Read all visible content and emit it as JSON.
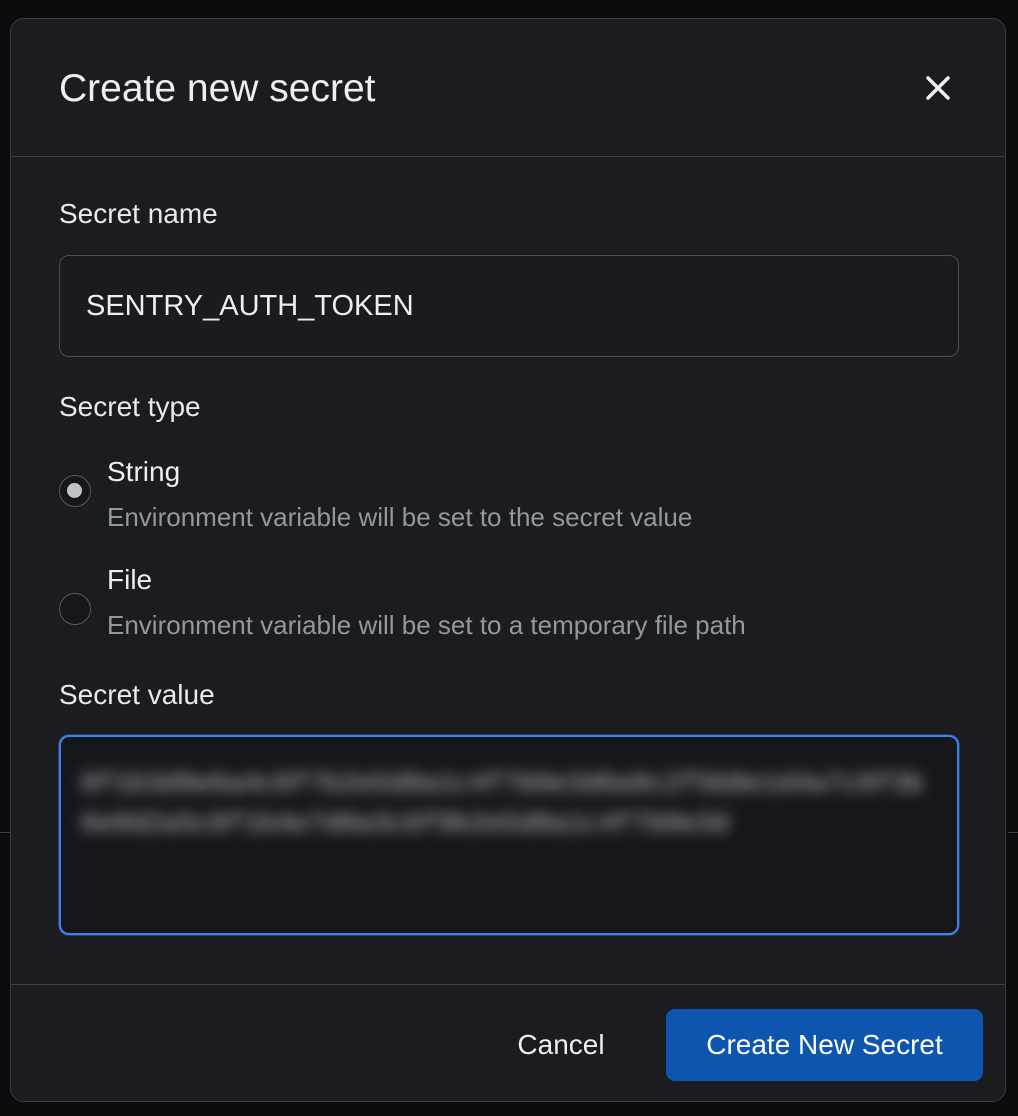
{
  "dialog": {
    "title": "Create new secret",
    "close_icon": "close-icon"
  },
  "form": {
    "name_label": "Secret name",
    "name_value": "SENTRY_AUTH_TOKEN",
    "type_label": "Secret type",
    "type_options": [
      {
        "label": "String",
        "description": "Environment variable will be set to the secret value",
        "selected": true
      },
      {
        "label": "File",
        "description": "Environment variable will be set to a temporary file path",
        "selected": false
      }
    ],
    "value_label": "Secret value",
    "value_text": "8f1b3d9e6a4c0f7b2e5d8a1c4f7b0e3d6a9c2f5b8e1d4a7c0f3b6e9d2a5c8f1b4e7d0a3c6f9b2e5d8a1c4f7b0e3d",
    "value_obscured": true
  },
  "footer": {
    "cancel_label": "Cancel",
    "submit_label": "Create New Secret"
  },
  "colors": {
    "accent": "#3d82f0",
    "primary_button": "#0d55ae",
    "surface": "#1b1c1f"
  }
}
